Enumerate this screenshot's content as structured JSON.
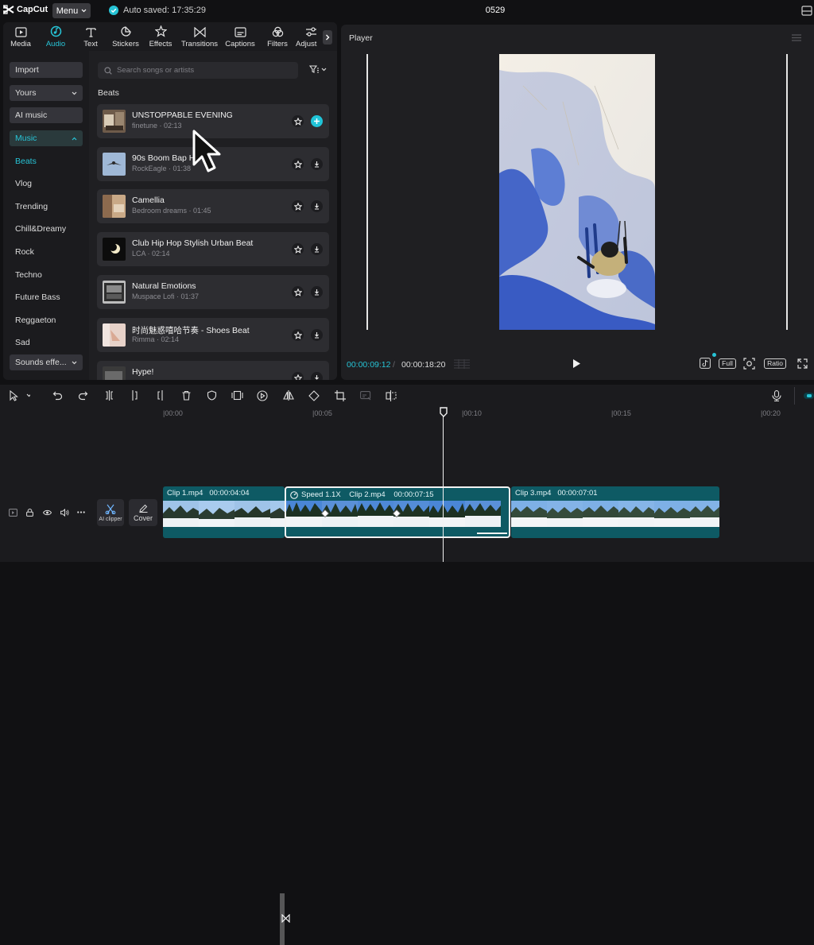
{
  "app": {
    "logo": "CapCut",
    "menu_label": "Menu",
    "autosave": "Auto saved: 17:35:29",
    "project_name": "0529"
  },
  "tabs": [
    {
      "label": "Media",
      "icon": "media-icon"
    },
    {
      "label": "Audio",
      "icon": "audio-icon",
      "active": true
    },
    {
      "label": "Text",
      "icon": "text-icon"
    },
    {
      "label": "Stickers",
      "icon": "stickers-icon"
    },
    {
      "label": "Effects",
      "icon": "effects-icon"
    },
    {
      "label": "Transitions",
      "icon": "transitions-icon"
    },
    {
      "label": "Captions",
      "icon": "captions-icon"
    },
    {
      "label": "Filters",
      "icon": "filters-icon"
    },
    {
      "label": "Adjust",
      "icon": "adjust-icon"
    }
  ],
  "sidebar": {
    "import": "Import",
    "yours": "Yours",
    "ai_music": "AI music",
    "music": "Music",
    "sub": [
      "Beats",
      "Vlog",
      "Trending",
      "Chill&Dreamy",
      "Rock",
      "Techno",
      "Future Bass",
      "Reggaeton",
      "Sad"
    ],
    "sounds": "Sounds effe..."
  },
  "search": {
    "placeholder": "Search songs or artists"
  },
  "section_title": "Beats",
  "tracks": [
    {
      "title": "UNSTOPPABLE EVENING",
      "meta": "finetune · 02:13",
      "action": "add"
    },
    {
      "title": "90s Boom Bap H",
      "meta": "RockEagle · 01:38",
      "action": "download"
    },
    {
      "title": "Camellia",
      "meta": "Bedroom dreams · 01:45",
      "action": "download"
    },
    {
      "title": "Club Hip Hop Stylish Urban Beat",
      "meta": "LCA · 02:14",
      "action": "download"
    },
    {
      "title": "Natural Emotions",
      "meta": "Muspace Lofi · 01:37",
      "action": "download"
    },
    {
      "title": "时尚魅惑嘻哈节奏 - Shoes Beat",
      "meta": "Rimma · 02:14",
      "action": "download"
    },
    {
      "title": "Hype!",
      "meta": "",
      "action": "download"
    }
  ],
  "player": {
    "title": "Player",
    "time_current": "00:00:09:12",
    "separator": "/",
    "time_total": "00:00:18:20",
    "full_label": "Full",
    "ratio_label": "Ratio"
  },
  "timeline": {
    "ticks": [
      "|00:00",
      "|00:05",
      "|00:10",
      "|00:15",
      "|00:20"
    ],
    "ai_clipper": "AI clipper",
    "cover": "Cover",
    "clips": [
      {
        "name": "Clip 1.mp4",
        "duration": "00:00:04:04"
      },
      {
        "speed": "Speed 1.1X",
        "name": "Clip 2.mp4",
        "duration": "00:00:07:15"
      },
      {
        "name": "Clip 3.mp4",
        "duration": "00:00:07:01"
      }
    ]
  },
  "colors": {
    "accent": "#27c4d6",
    "clip": "#0e5a64",
    "panel": "#1f1f22"
  }
}
